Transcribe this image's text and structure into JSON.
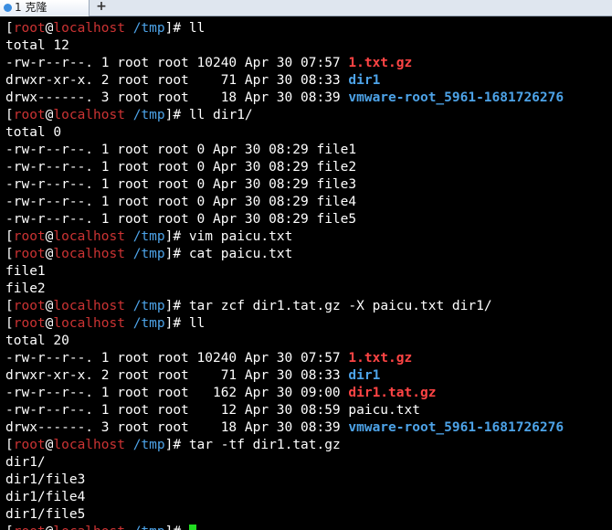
{
  "window": {
    "tab_title": "1 克隆",
    "add_tab": "+"
  },
  "prompt": {
    "user": "root",
    "at": "@",
    "host": "localhost",
    "path": "/tmp",
    "suffix": "]#",
    "open": "["
  },
  "colors": {
    "prompt_user_host": "#cc3333",
    "prompt_path": "#4da3e8",
    "archive_file": "#ff4444",
    "directory": "#4da3e8",
    "cursor": "#22dd22"
  },
  "lines": [
    {
      "kind": "prompt",
      "cmd": "ll"
    },
    {
      "kind": "text",
      "text": "total 12"
    },
    {
      "kind": "ls",
      "meta": "-rw-r--r--. 1 root root 10240 Apr 30 07:57 ",
      "name": "1.txt.gz",
      "type": "archive"
    },
    {
      "kind": "ls",
      "meta": "drwxr-xr-x. 2 root root    71 Apr 30 08:33 ",
      "name": "dir1",
      "type": "dir"
    },
    {
      "kind": "ls",
      "meta": "drwx------. 3 root root    18 Apr 30 08:39 ",
      "name": "vmware-root_5961-1681726276",
      "type": "dir"
    },
    {
      "kind": "prompt",
      "cmd": "ll dir1/"
    },
    {
      "kind": "text",
      "text": "total 0"
    },
    {
      "kind": "ls",
      "meta": "-rw-r--r--. 1 root root 0 Apr 30 08:29 ",
      "name": "file1",
      "type": "file"
    },
    {
      "kind": "ls",
      "meta": "-rw-r--r--. 1 root root 0 Apr 30 08:29 ",
      "name": "file2",
      "type": "file"
    },
    {
      "kind": "ls",
      "meta": "-rw-r--r--. 1 root root 0 Apr 30 08:29 ",
      "name": "file3",
      "type": "file"
    },
    {
      "kind": "ls",
      "meta": "-rw-r--r--. 1 root root 0 Apr 30 08:29 ",
      "name": "file4",
      "type": "file"
    },
    {
      "kind": "ls",
      "meta": "-rw-r--r--. 1 root root 0 Apr 30 08:29 ",
      "name": "file5",
      "type": "file"
    },
    {
      "kind": "prompt",
      "cmd": "vim paicu.txt"
    },
    {
      "kind": "prompt",
      "cmd": "cat paicu.txt"
    },
    {
      "kind": "text",
      "text": "file1"
    },
    {
      "kind": "text",
      "text": "file2"
    },
    {
      "kind": "prompt",
      "cmd": "tar zcf dir1.tat.gz -X paicu.txt dir1/"
    },
    {
      "kind": "prompt",
      "cmd": "ll"
    },
    {
      "kind": "text",
      "text": "total 20"
    },
    {
      "kind": "ls",
      "meta": "-rw-r--r--. 1 root root 10240 Apr 30 07:57 ",
      "name": "1.txt.gz",
      "type": "archive"
    },
    {
      "kind": "ls",
      "meta": "drwxr-xr-x. 2 root root    71 Apr 30 08:33 ",
      "name": "dir1",
      "type": "dir"
    },
    {
      "kind": "ls",
      "meta": "-rw-r--r--. 1 root root   162 Apr 30 09:00 ",
      "name": "dir1.tat.gz",
      "type": "archive"
    },
    {
      "kind": "ls",
      "meta": "-rw-r--r--. 1 root root    12 Apr 30 08:59 ",
      "name": "paicu.txt",
      "type": "file"
    },
    {
      "kind": "ls",
      "meta": "drwx------. 3 root root    18 Apr 30 08:39 ",
      "name": "vmware-root_5961-1681726276",
      "type": "dir"
    },
    {
      "kind": "prompt",
      "cmd": "tar -tf dir1.tat.gz"
    },
    {
      "kind": "text",
      "text": "dir1/"
    },
    {
      "kind": "text",
      "text": "dir1/file3"
    },
    {
      "kind": "text",
      "text": "dir1/file4"
    },
    {
      "kind": "text",
      "text": "dir1/file5"
    },
    {
      "kind": "prompt",
      "cmd": "",
      "cursor": true
    }
  ]
}
